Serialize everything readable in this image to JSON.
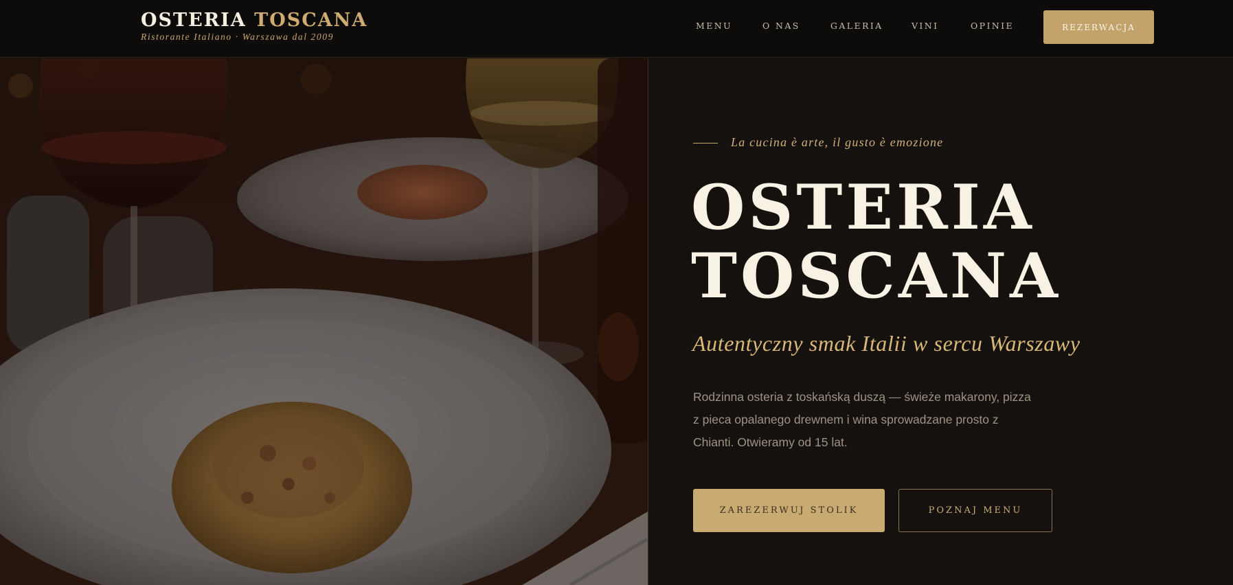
{
  "header": {
    "brand_primary": "OSTERIA",
    "brand_accent": "TOSCANA",
    "brand_subtitle": "Ristorante Italiano · Warszawa dal 2009",
    "nav": [
      {
        "label": "MENU"
      },
      {
        "label": "O NAS"
      },
      {
        "label": "GALERIA"
      },
      {
        "label": "VINI"
      },
      {
        "label": "OPINIE"
      }
    ],
    "reserve_label": "REZERWACJA"
  },
  "hero": {
    "tagline": "La cucina è arte, il gusto è emozione",
    "title_line1": "OSTERIA",
    "title_line2": "TOSCANA",
    "subtitle": "Autentyczny smak Italii w sercu Warszawy",
    "description": [
      "Rodzinna osteria z toskańską duszą — świeże makarony, pizza",
      "z pieca opalanego drewnem i wina sprowadzane prosto z",
      "Chianti. Otwieramy od 15 lat."
    ],
    "primary_cta": "ZAREZERWUJ STOLIK",
    "secondary_cta": "POZNAJ MENU"
  },
  "colors": {
    "accent_gold": "#c9ab72",
    "background": "#15110e",
    "header_bg": "#0e0c0a"
  }
}
